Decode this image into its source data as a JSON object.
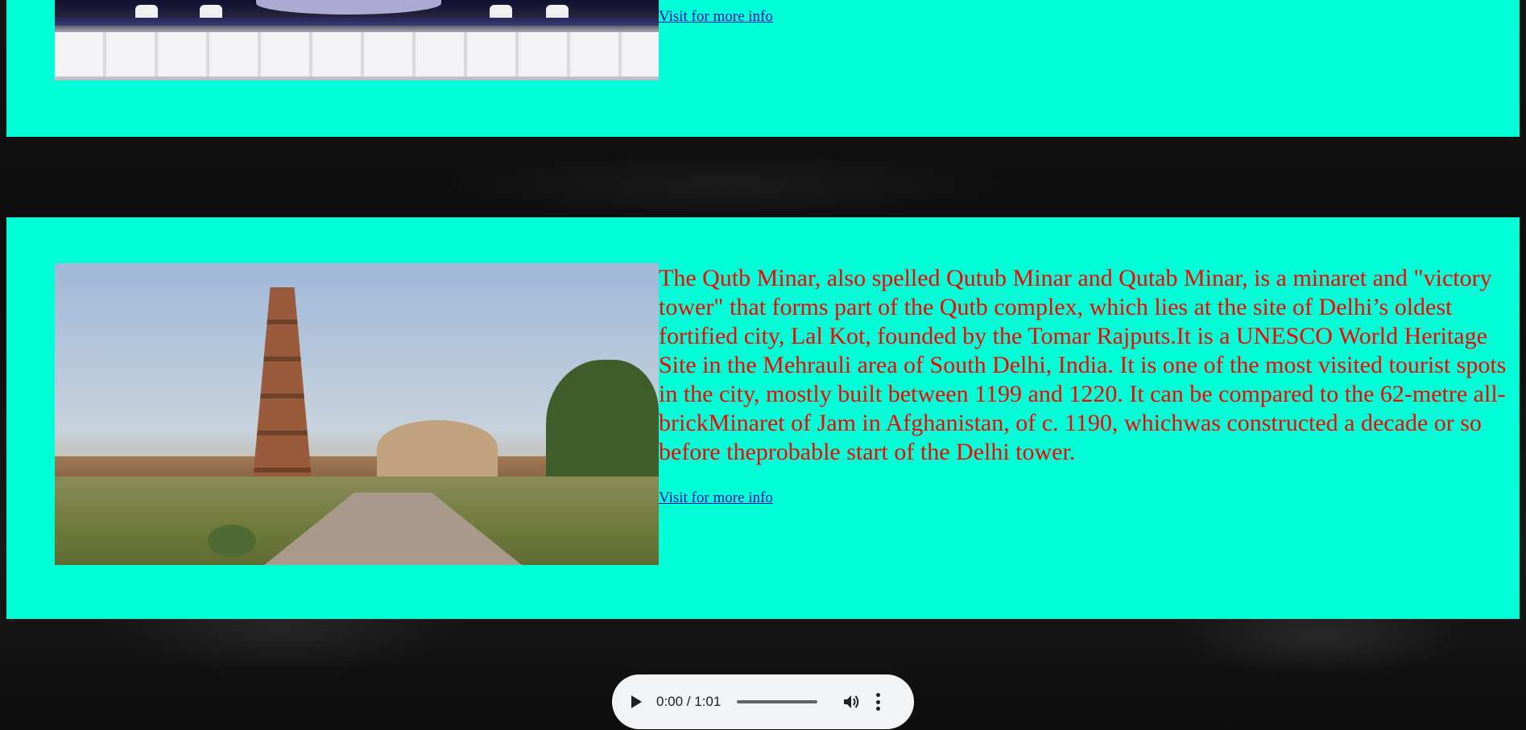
{
  "sections": [
    {
      "image_name": "Taj Mahal",
      "link_label": "Visit for more info"
    },
    {
      "image_name": "Qutb Minar",
      "description": "The Qutb Minar, also spelled Qutub Minar and Qutab Minar, is a minaret and \"victory tower\" that forms part of the Qutb complex, which lies at the site of Delhi’s oldest fortified city, Lal Kot, founded by the Tomar Rajputs.It is a UNESCO World Heritage Site in the Mehrauli area of South Delhi, India. It is one of the most visited tourist spots in the city, mostly built between 1199 and 1220. It can be compared to the 62-metre all-brickMinaret of Jam in Afghanistan, of c. 1190, whichwas constructed a decade or so before theprobable start of the Delhi tower.",
      "link_label": "Visit for more info"
    }
  ],
  "audio": {
    "time": "0:00 / 1:01",
    "icons": [
      "play-icon",
      "volume-icon",
      "more-options-icon"
    ]
  },
  "colors": {
    "card_background": "#00ffd6",
    "description_text": "#ff0000",
    "link": "#1a0dab",
    "page_background": "#111111"
  }
}
